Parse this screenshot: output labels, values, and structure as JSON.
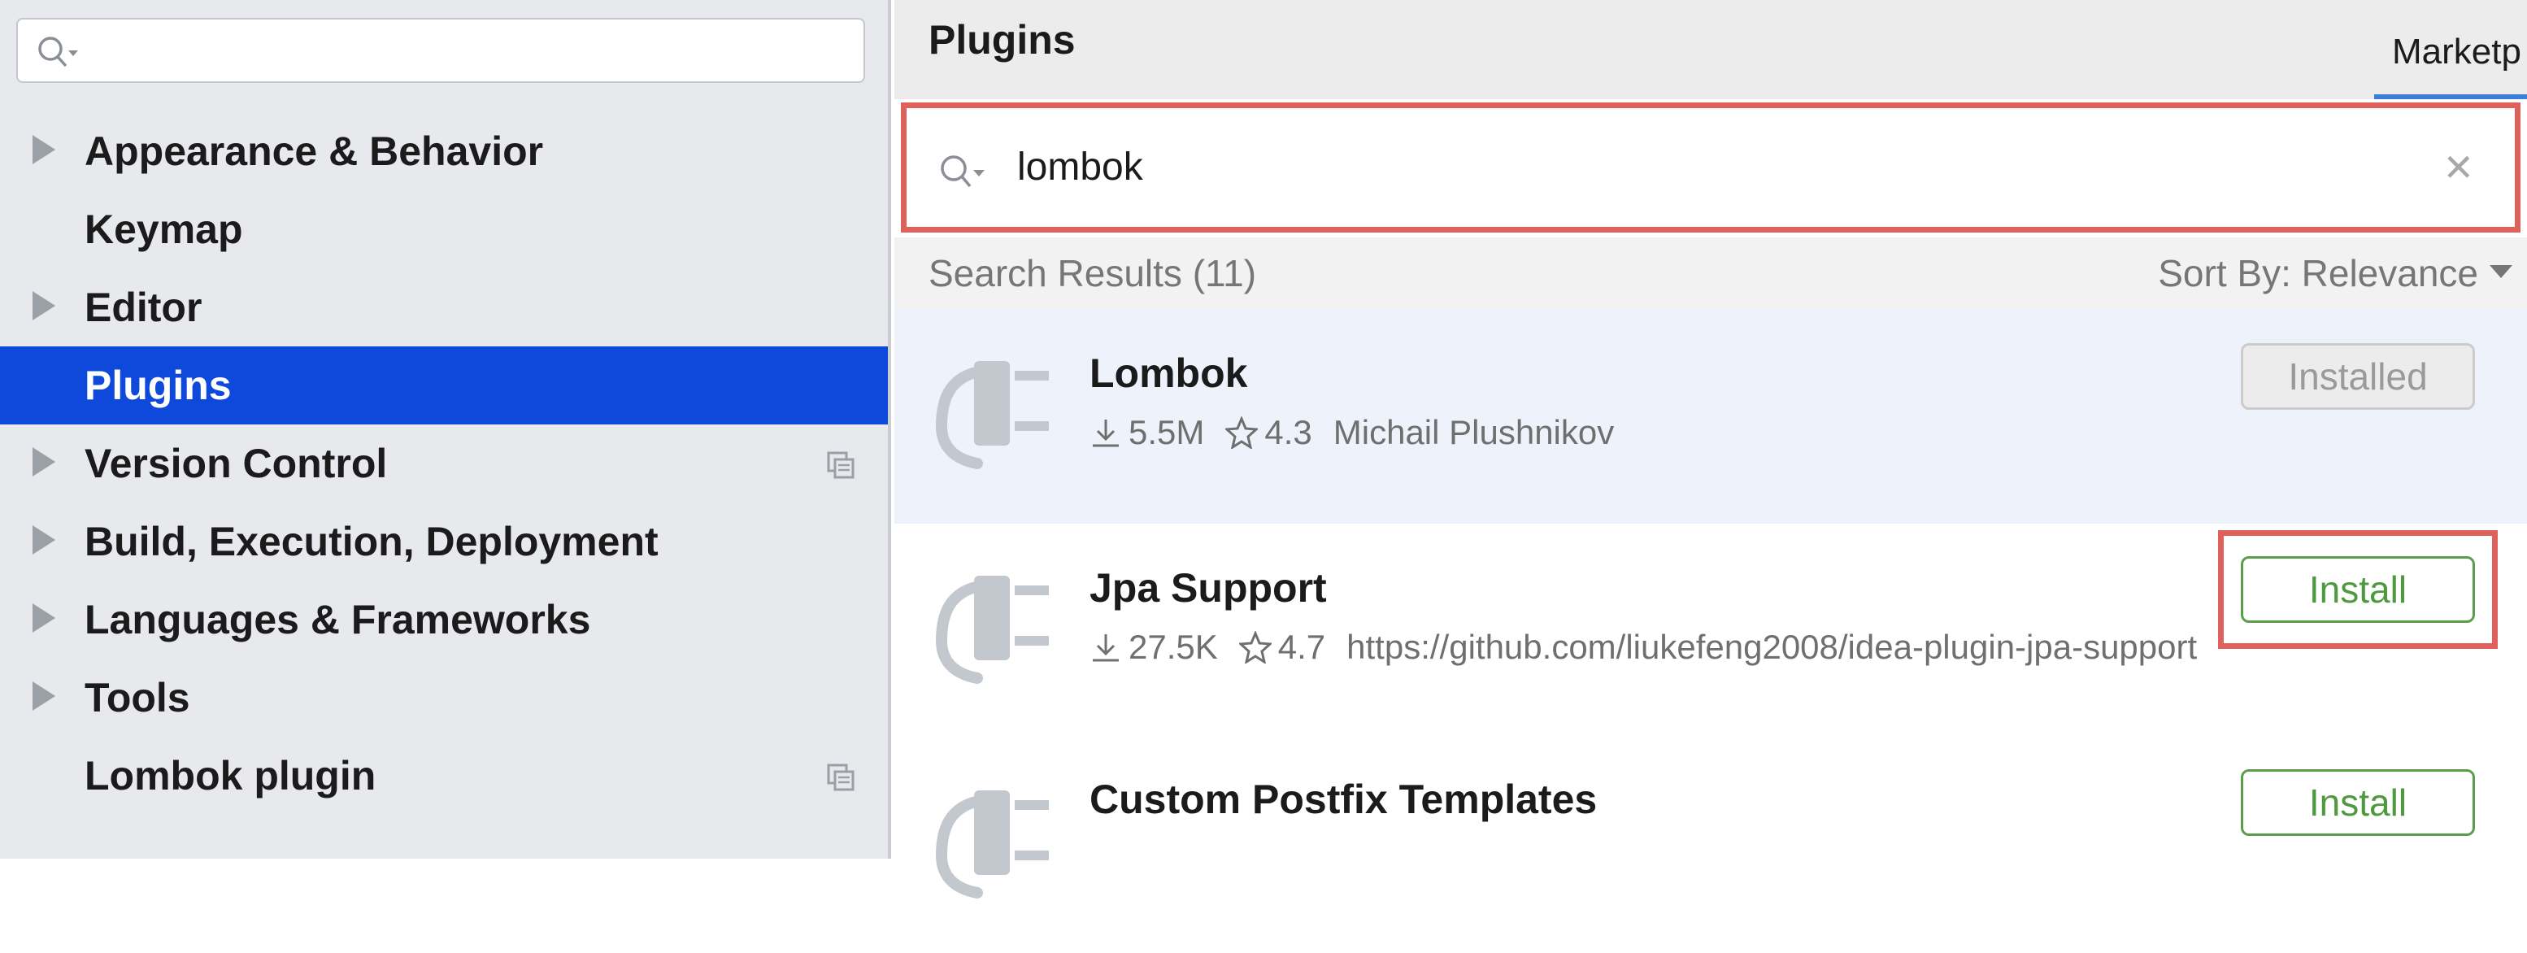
{
  "sidebar": {
    "search": {
      "value": ""
    },
    "items": [
      {
        "label": "Appearance & Behavior",
        "expandable": true
      },
      {
        "label": "Keymap",
        "expandable": false
      },
      {
        "label": "Editor",
        "expandable": true
      },
      {
        "label": "Plugins",
        "expandable": false,
        "selected": true
      },
      {
        "label": "Version Control",
        "expandable": true,
        "project_icon": true
      },
      {
        "label": "Build, Execution, Deployment",
        "expandable": true
      },
      {
        "label": "Languages & Frameworks",
        "expandable": true
      },
      {
        "label": "Tools",
        "expandable": true
      },
      {
        "label": "Lombok plugin",
        "expandable": false,
        "project_icon": true
      }
    ]
  },
  "header": {
    "title": "Plugins",
    "tab_marketplace": "Marketp"
  },
  "search": {
    "value": "lombok",
    "clear_icon": "close-icon"
  },
  "results": {
    "count_label": "Search Results (11)",
    "sort_label": "Sort By: Relevance"
  },
  "plugins": [
    {
      "name": "Lombok",
      "downloads": "5.5M",
      "rating": "4.3",
      "vendor": "Michail Plushnikov",
      "action": "Installed"
    },
    {
      "name": "Jpa Support",
      "downloads": "27.5K",
      "rating": "4.7",
      "vendor": "https://github.com/liukefeng2008/idea-plugin-jpa-support",
      "action": "Install"
    },
    {
      "name": "Custom Postfix Templates",
      "action": "Install"
    }
  ],
  "colors": {
    "selection": "#0f49dc",
    "highlight_border": "#e0615c",
    "install_green": "#4f9a3f"
  }
}
